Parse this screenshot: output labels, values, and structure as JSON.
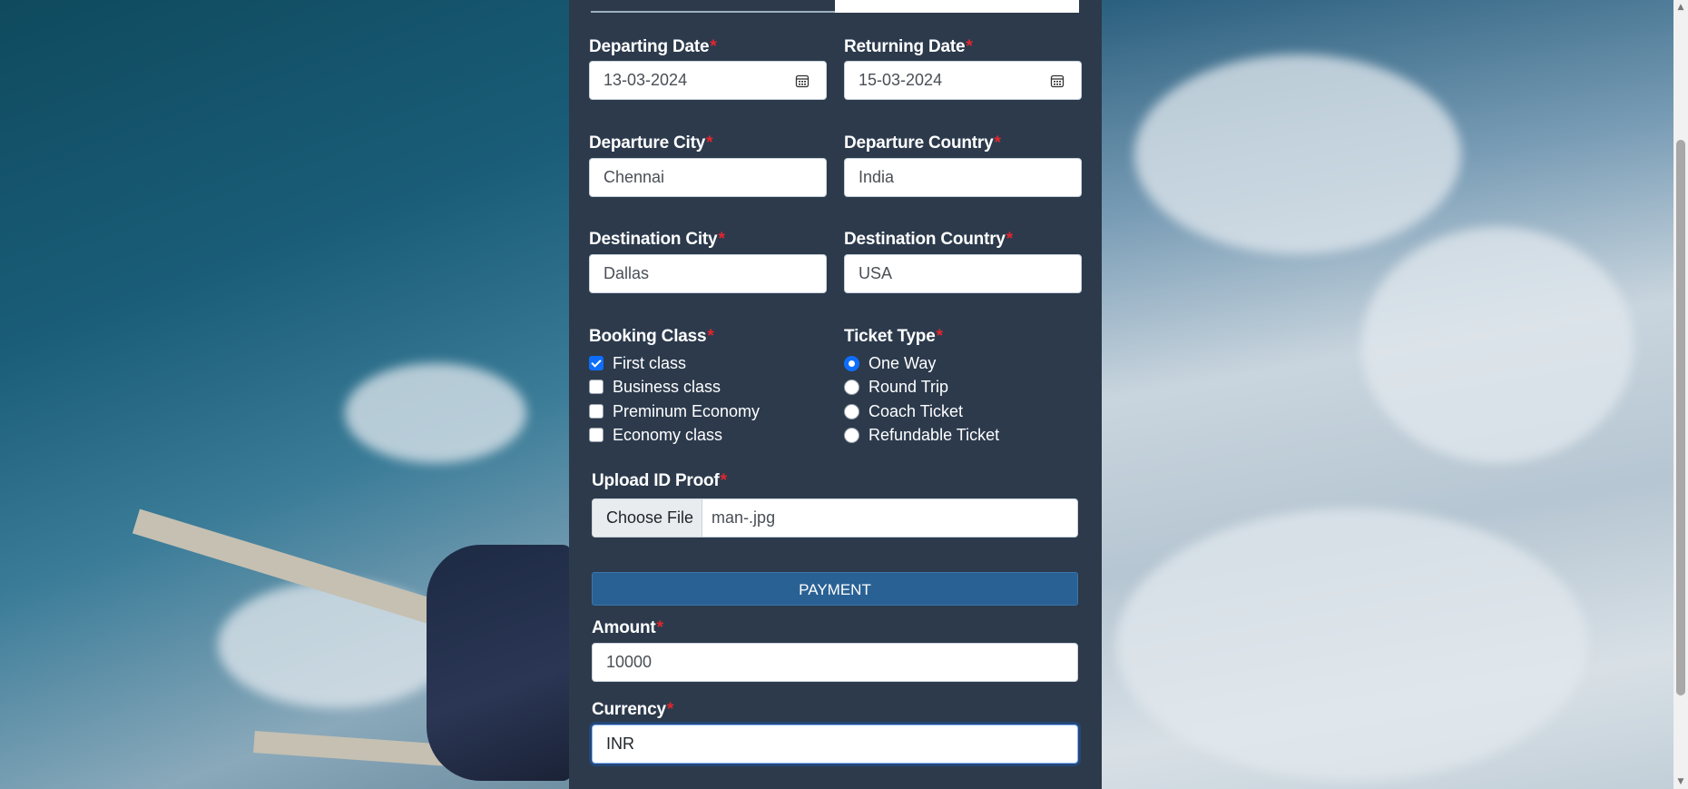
{
  "form": {
    "departing_date": {
      "label": "Departing Date",
      "required": "*",
      "value": "13-03-2024"
    },
    "returning_date": {
      "label": "Returning Date",
      "required": "*",
      "value": "15-03-2024"
    },
    "departure_city": {
      "label": "Departure City",
      "required": "*",
      "value": "Chennai"
    },
    "departure_country": {
      "label": "Departure Country",
      "required": "*",
      "value": "India"
    },
    "destination_city": {
      "label": "Destination City",
      "required": "*",
      "value": "Dallas"
    },
    "destination_country": {
      "label": "Destination Country",
      "required": "*",
      "value": "USA"
    },
    "booking_class": {
      "label": "Booking Class",
      "required": "*",
      "options": [
        {
          "label": "First class",
          "checked": true
        },
        {
          "label": "Business class",
          "checked": false
        },
        {
          "label": "Preminum Economy",
          "checked": false
        },
        {
          "label": "Economy class",
          "checked": false
        }
      ]
    },
    "ticket_type": {
      "label": "Ticket Type",
      "required": "*",
      "options": [
        {
          "label": "One Way",
          "selected": true
        },
        {
          "label": "Round Trip",
          "selected": false
        },
        {
          "label": "Coach Ticket",
          "selected": false
        },
        {
          "label": "Refundable Ticket",
          "selected": false
        }
      ]
    },
    "upload_id": {
      "label": "Upload ID Proof",
      "required": "*",
      "button_label": "Choose File",
      "file_name": "man-.jpg"
    },
    "payment_section": {
      "label": "PAYMENT"
    },
    "amount": {
      "label": "Amount",
      "required": "*",
      "value": "10000"
    },
    "currency": {
      "label": "Currency",
      "required": "*",
      "value": "INR"
    }
  },
  "icons": {
    "calendar": "calendar-icon",
    "scroll_up": "scroll-up-arrow-icon",
    "scroll_down": "scroll-down-arrow-icon"
  },
  "colors": {
    "panel_background": "#2c3a4c",
    "required_marker": "#e3262e",
    "payment_bar": "#2a6194",
    "accent": "#0d6efd"
  }
}
